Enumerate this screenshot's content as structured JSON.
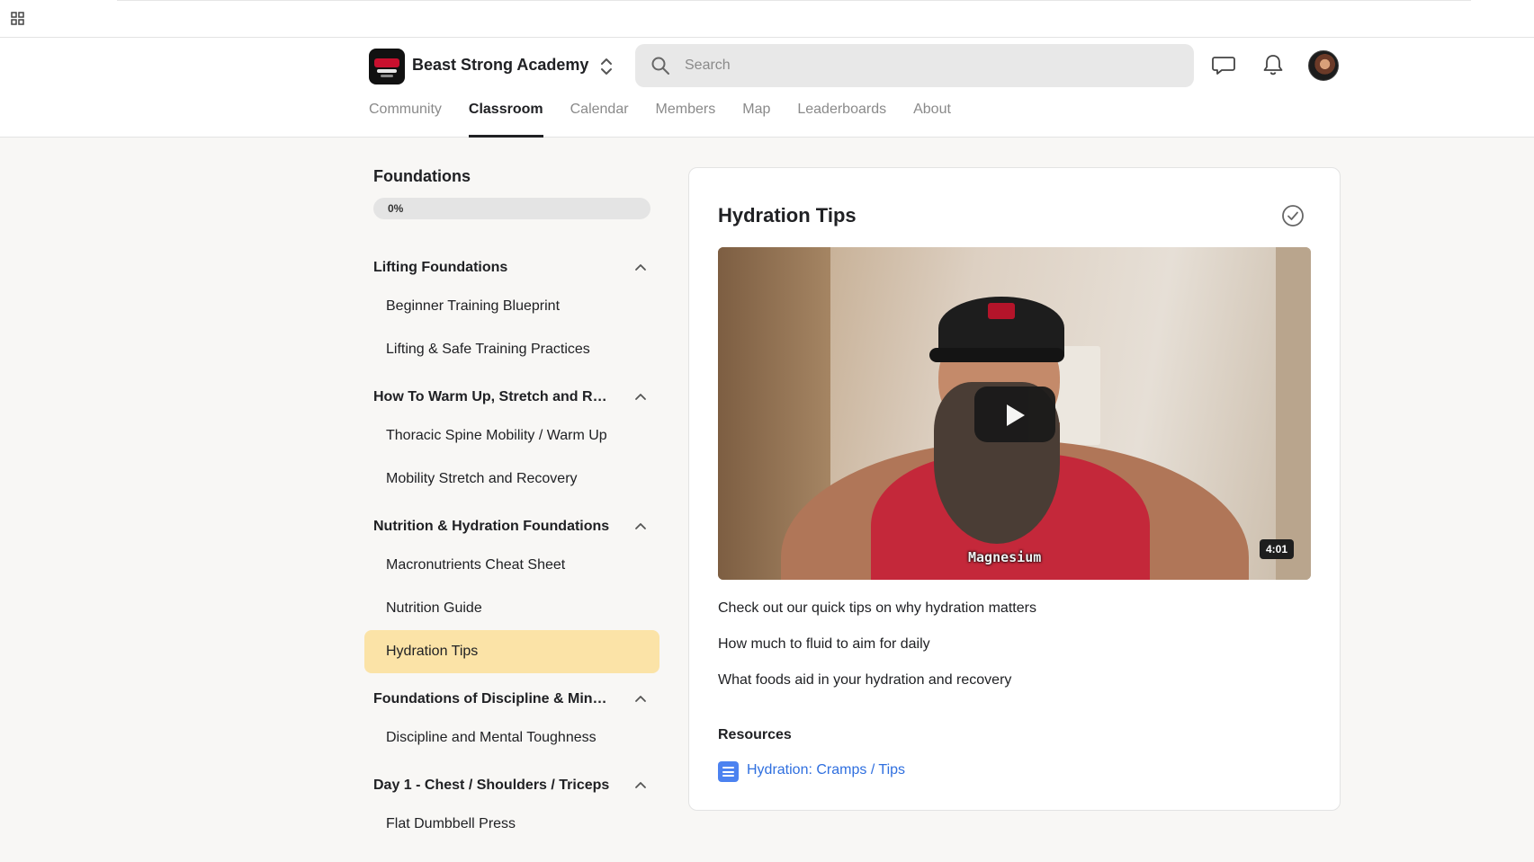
{
  "header": {
    "group_name": "Beast Strong Academy",
    "search_placeholder": "Search",
    "tabs": [
      {
        "label": "Community"
      },
      {
        "label": "Classroom"
      },
      {
        "label": "Calendar"
      },
      {
        "label": "Members"
      },
      {
        "label": "Map"
      },
      {
        "label": "Leaderboards"
      },
      {
        "label": "About"
      }
    ],
    "active_tab": "Classroom"
  },
  "sidebar": {
    "course_title": "Foundations",
    "progress_label": "0%",
    "progress_value": 0,
    "modules": [
      {
        "title": "Lifting Foundations",
        "lessons": [
          "Beginner Training Blueprint",
          "Lifting & Safe Training Practices"
        ]
      },
      {
        "title": "How To Warm Up, Stretch and Reco...",
        "lessons": [
          "Thoracic Spine Mobility / Warm Up",
          "Mobility Stretch and Recovery"
        ]
      },
      {
        "title": "Nutrition & Hydration Foundations",
        "lessons": [
          "Macronutrients Cheat Sheet",
          "Nutrition Guide",
          "Hydration Tips"
        ]
      },
      {
        "title": "Foundations of Discipline & Mindset",
        "lessons": [
          "Discipline and Mental Toughness"
        ]
      },
      {
        "title": "Day 1 - Chest / Shoulders / Triceps",
        "lessons": [
          "Flat Dumbbell Press"
        ]
      }
    ],
    "active_lesson": "Hydration Tips"
  },
  "lesson": {
    "title": "Hydration Tips",
    "video": {
      "caption": "Magnesium",
      "duration": "4:01"
    },
    "description": [
      "Check out our quick tips on why hydration matters",
      "How much to fluid to aim for daily",
      "What foods aid in your hydration and recovery"
    ],
    "resources_heading": "Resources",
    "resources": [
      {
        "label": "Hydration: Cramps / Tips",
        "icon": "document-icon"
      }
    ]
  },
  "colors": {
    "active_lesson_bg": "#fbe3a7",
    "link": "#2f6fdf",
    "doc_icon": "#4c82f0"
  }
}
